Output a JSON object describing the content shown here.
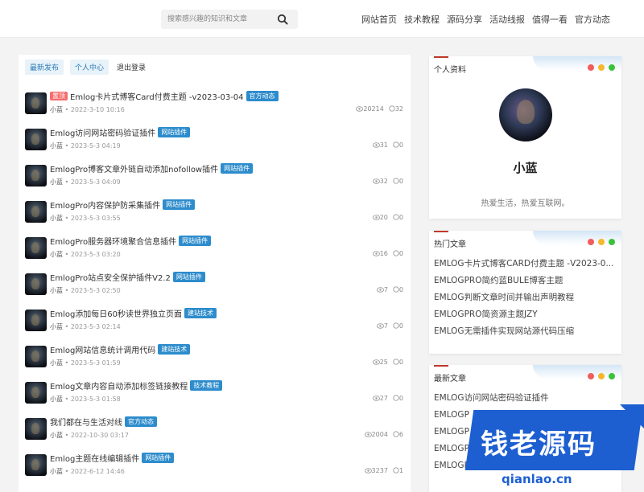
{
  "header": {
    "search_placeholder": "搜索感兴趣的知识和文章",
    "nav": [
      "网站首页",
      "技术教程",
      "源码分享",
      "活动线报",
      "值得一看",
      "官方动态"
    ]
  },
  "tabs": [
    "最新发布",
    "个人中心",
    "退出登录"
  ],
  "posts": [
    {
      "hot": "置顶",
      "title": "Emlog卡片式博客Card付费主题 -v2023-03-04",
      "badge": "官方动态",
      "author": "小蓝",
      "date": "2022-3-10 10:16",
      "views": "20214",
      "comments": "32"
    },
    {
      "title": "Emlog访问网站密码验证插件",
      "badge": "网站插件",
      "author": "小蓝",
      "date": "2023-5-3 04:19",
      "views": "31",
      "comments": "0"
    },
    {
      "title": "EmlogPro博客文章外链自动添加nofollow插件",
      "badge": "网站插件",
      "author": "小蓝",
      "date": "2023-5-3 04:09",
      "views": "32",
      "comments": "0"
    },
    {
      "title": "EmlogPro内容保护防采集插件",
      "badge": "网站插件",
      "author": "小蓝",
      "date": "2023-5-3 03:55",
      "views": "20",
      "comments": "0"
    },
    {
      "title": "EmlogPro服务器环境聚合信息插件",
      "badge": "网站插件",
      "author": "小蓝",
      "date": "2023-5-3 03:20",
      "views": "16",
      "comments": "0"
    },
    {
      "title": "EmlogPro站点安全保护插件V2.2",
      "badge": "网站插件",
      "author": "小蓝",
      "date": "2023-5-3 02:50",
      "views": "7",
      "comments": "0"
    },
    {
      "title": "Emlog添加每日60秒读世界独立页面",
      "badge": "建站技术",
      "author": "小蓝",
      "date": "2023-5-3 02:14",
      "views": "7",
      "comments": "0"
    },
    {
      "title": "Emlog网站信息统计调用代码",
      "badge": "建站技术",
      "author": "小蓝",
      "date": "2023-5-3 01:59",
      "views": "25",
      "comments": "0"
    },
    {
      "title": "Emlog文章内容自动添加标签链接教程",
      "badge": "技术教程",
      "author": "小蓝",
      "date": "2023-5-3 01:58",
      "views": "27",
      "comments": "0"
    },
    {
      "title": "我们都在与生活对线",
      "badge": "官方动态",
      "author": "小蓝",
      "date": "2022-10-30 03:17",
      "views": "2004",
      "comments": "6"
    },
    {
      "title": "Emlog主题在线编辑插件",
      "badge": "网站插件",
      "author": "小蓝",
      "date": "2022-6-12 14:46",
      "views": "3237",
      "comments": "1"
    }
  ],
  "profile": {
    "title": "个人资料",
    "name": "小蓝",
    "desc": "热爱生活，热爱互联网。"
  },
  "hot": {
    "title": "热门文章",
    "items": [
      "EMLOG卡片式博客CARD付费主题 -V2023-0...",
      "EMLOGPRO简约蓝BULE博客主题",
      "EMLOG判断文章时间并输出声明教程",
      "EMLOGPRO简资源主题JZY",
      "EMLOG无需插件实现网站源代码压缩"
    ]
  },
  "latest": {
    "title": "最新文章",
    "items": [
      "EMLOG访问网站密码验证插件",
      "EMLOGP",
      "EMLOGP",
      "EMLOGP",
      "EMLOGP"
    ]
  },
  "watermark": {
    "text": "钱老源码",
    "url": "qianlao.cn"
  },
  "colors": {
    "accent": "#2d8ccc",
    "tab_bg": "#e8f2f9",
    "dot_red": "#f25c5c",
    "dot_yellow": "#f5b82e",
    "dot_green": "#3cc13b"
  }
}
